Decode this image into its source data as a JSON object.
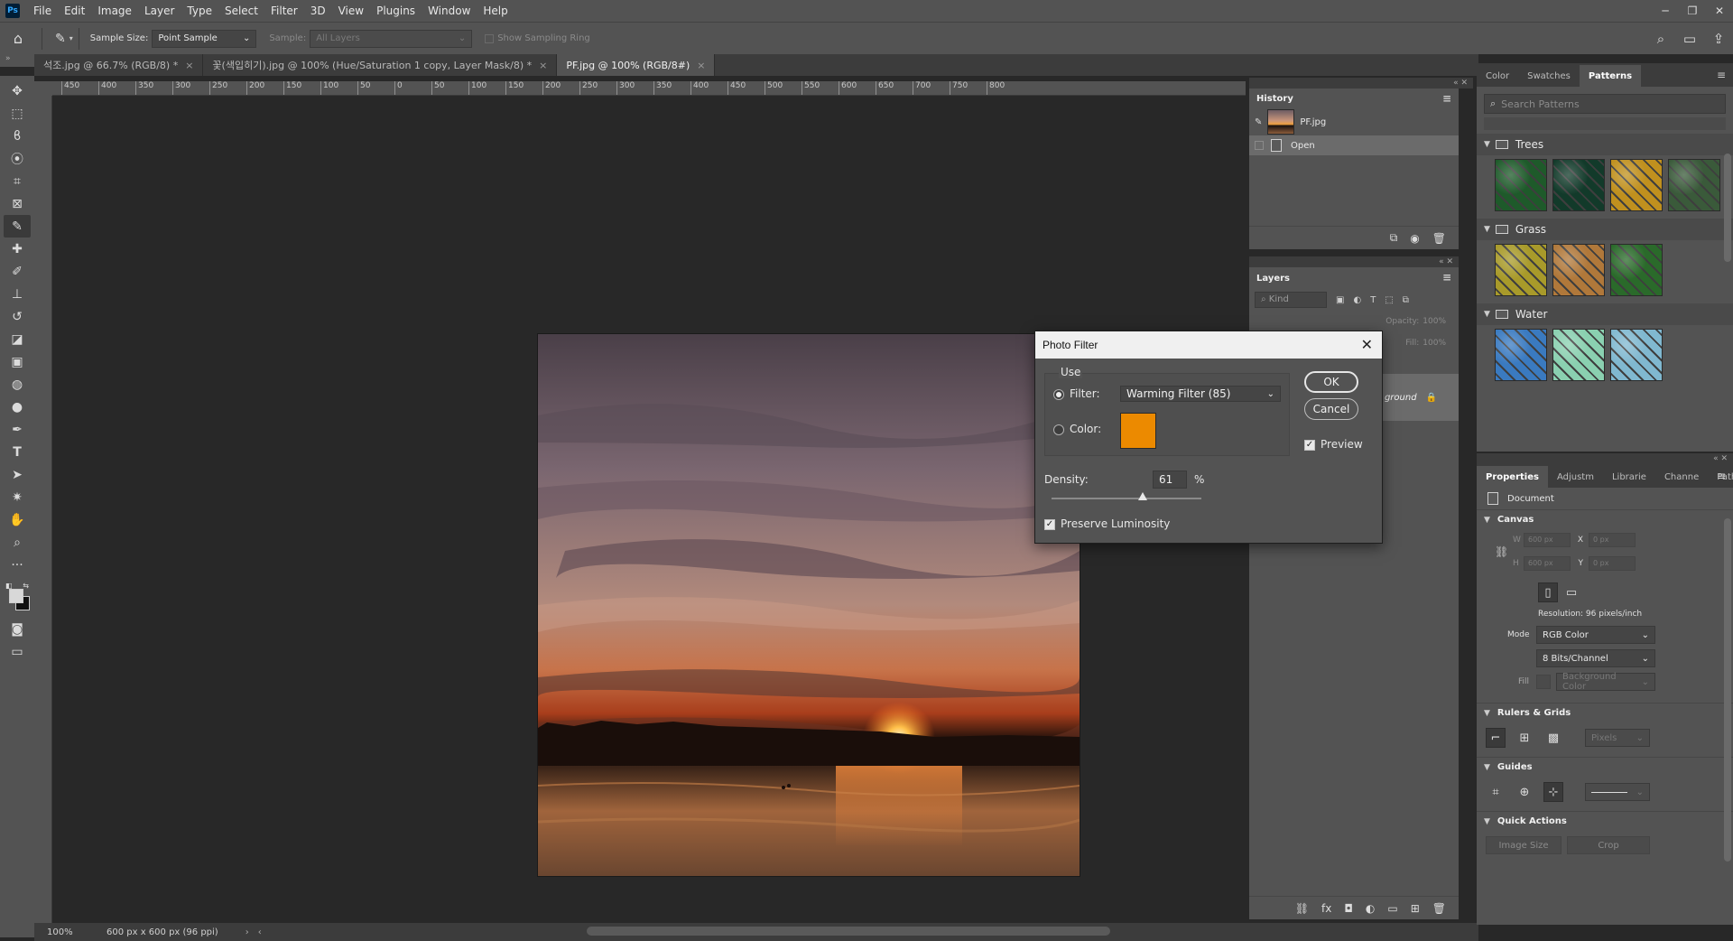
{
  "app": {
    "logo": "Ps",
    "menu": [
      "File",
      "Edit",
      "Image",
      "Layer",
      "Type",
      "Select",
      "Filter",
      "3D",
      "View",
      "Plugins",
      "Window",
      "Help"
    ],
    "window_controls": [
      "─",
      "❐",
      "✕"
    ]
  },
  "options": {
    "sample_size_label": "Sample Size:",
    "sample_size_value": "Point Sample",
    "sample_label": "Sample:",
    "sample_value": "All Layers",
    "show_ring_label": "Show Sampling Ring"
  },
  "tabs": [
    {
      "label": "석조.jpg @ 66.7% (RGB/8) *",
      "active": false
    },
    {
      "label": "꽃(색입히기).jpg @ 100% (Hue/Saturation 1 copy, Layer Mask/8) *",
      "active": false
    },
    {
      "label": "PF.jpg @ 100% (RGB/8#)",
      "active": true
    }
  ],
  "ruler_ticks": [
    "450",
    "400",
    "350",
    "300",
    "250",
    "200",
    "150",
    "100",
    "50",
    "0",
    "50",
    "100",
    "150",
    "200",
    "250",
    "300",
    "350",
    "400",
    "450",
    "500",
    "550",
    "600",
    "650",
    "700",
    "750",
    "800"
  ],
  "status": {
    "zoom": "100%",
    "doc_size": "600 px x 600 px (96 ppi)"
  },
  "history": {
    "title": "History",
    "snapshot_name": "PF.jpg",
    "steps": [
      "Open"
    ]
  },
  "layers": {
    "title": "Layers",
    "kind_placeholder": "Kind",
    "opacity_label": "Opacity:",
    "opacity_value": "100%",
    "fill_label": "Fill:",
    "fill_value": "100%",
    "layer_name_partial": "ground"
  },
  "patterns": {
    "tabs": [
      "Color",
      "Swatches",
      "Patterns"
    ],
    "active_tab": "Patterns",
    "search_placeholder": "Search Patterns",
    "groups": [
      {
        "name": "Trees",
        "colors": [
          "#1e5a2a",
          "#123a2a",
          "#c0901e",
          "#3a5a3a"
        ]
      },
      {
        "name": "Grass",
        "colors": [
          "#a89a2a",
          "#b0783a",
          "#2a6a2a"
        ]
      },
      {
        "name": "Water",
        "colors": [
          "#3a7ac0",
          "#8ad0b0",
          "#80b8d0"
        ]
      }
    ]
  },
  "properties": {
    "tabs": [
      "Properties",
      "Adjustm",
      "Librarie",
      "Channe",
      "Paths"
    ],
    "active_tab": "Properties",
    "document_label": "Document",
    "canvas": {
      "title": "Canvas",
      "w_label": "W",
      "w_value": "600 px",
      "h_label": "H",
      "h_value": "600 px",
      "x_label": "X",
      "x_value": "0 px",
      "y_label": "Y",
      "y_value": "0 px",
      "resolution": "Resolution: 96 pixels/inch",
      "mode_label": "Mode",
      "mode_value": "RGB Color",
      "bits_value": "8 Bits/Channel",
      "fill_label": "Fill",
      "fill_value": "Background Color"
    },
    "rulers_grids": {
      "title": "Rulers & Grids",
      "unit": "Pixels"
    },
    "guides": {
      "title": "Guides"
    },
    "quick_actions": {
      "title": "Quick Actions",
      "buttons": [
        "Image Size",
        "Crop"
      ]
    }
  },
  "dialog": {
    "title": "Photo Filter",
    "use_label": "Use",
    "filter_label": "Filter:",
    "filter_value": "Warming Filter (85)",
    "color_label": "Color:",
    "color_value": "#ec8a00",
    "density_label": "Density:",
    "density_value": "61",
    "density_unit": "%",
    "density_fraction": 0.61,
    "preserve_label": "Preserve Luminosity",
    "preview_label": "Preview",
    "ok_label": "OK",
    "cancel_label": "Cancel"
  }
}
